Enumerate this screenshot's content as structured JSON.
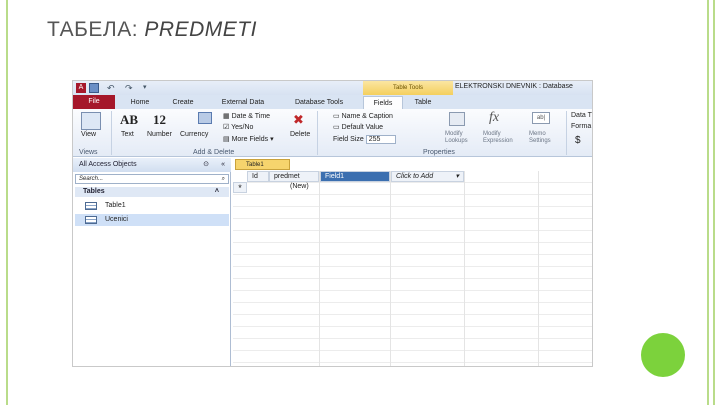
{
  "slide": {
    "title_prefix": "ТАБЕЛА:",
    "title_italic": "PREDMETI"
  },
  "window": {
    "title": "ELEKTRONSKI DNEVNIK : Database",
    "context_tab": "Table Tools"
  },
  "ribbon_tabs": [
    "File",
    "Home",
    "Create",
    "External Data",
    "Database Tools",
    "Fields",
    "Table"
  ],
  "ribbon": {
    "view": "View",
    "text": "Text",
    "number": "Number",
    "currency": "Currency",
    "text_glyph": "AB",
    "number_glyph": "12",
    "date_time": "Date & Time",
    "yes_no": "Yes/No",
    "more_fields": "More Fields ▾",
    "delete": "Delete",
    "name_caption": "Name & Caption",
    "default_value": "Default Value",
    "field_size_label": "Field Size",
    "field_size_value": "255",
    "modify_lookups": "Modify Lookups",
    "modify_expression": "Modify Expression",
    "memo_settings": "Memo Settings",
    "data_type": "Data T",
    "format": "Forma",
    "currency_symbol": "$",
    "groups": {
      "views": "Views",
      "add_delete": "Add & Delete",
      "properties": "Properties"
    }
  },
  "nav": {
    "header": "All Access Objects",
    "search_placeholder": "Search...",
    "section": "Tables",
    "items": [
      "Table1",
      "Ucenici"
    ]
  },
  "document": {
    "tab": "Table1",
    "columns": [
      "Id",
      "predmet",
      "Field1",
      "Click to Add"
    ],
    "new_row_label": "(New)",
    "new_row_marker": "*"
  },
  "colors": {
    "file_tab": "#a5172a",
    "context_tab": "#f4cf5e",
    "accent_dot": "#7cd23c",
    "frame_lines": "#b9dc8a"
  }
}
